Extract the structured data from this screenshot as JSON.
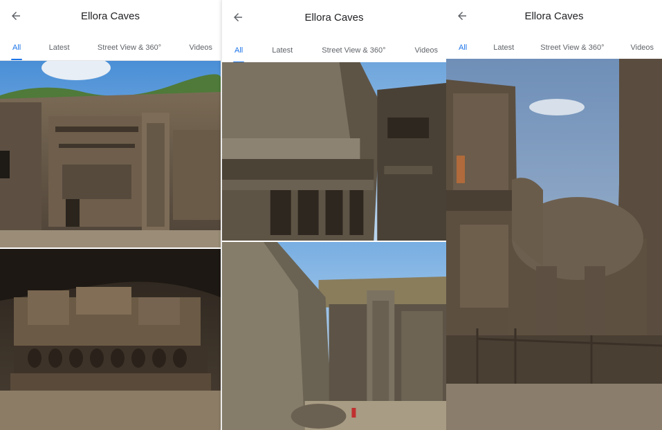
{
  "screens": [
    {
      "title": "Ellora Caves",
      "tabs": [
        "All",
        "Latest",
        "Street View & 360°",
        "Videos"
      ],
      "active_tab": "All"
    },
    {
      "title": "Ellora Caves",
      "tabs": [
        "All",
        "Latest",
        "Street View & 360°",
        "Videos"
      ],
      "active_tab": "All"
    },
    {
      "title": "Ellora Caves",
      "tabs": [
        "All",
        "Latest",
        "Street View & 360°",
        "Videos"
      ],
      "active_tab": "All"
    }
  ],
  "icons": {
    "back": "arrow-back-icon"
  },
  "colors": {
    "accent": "#1a73e8",
    "text": "#202124",
    "muted": "#5f6368"
  }
}
